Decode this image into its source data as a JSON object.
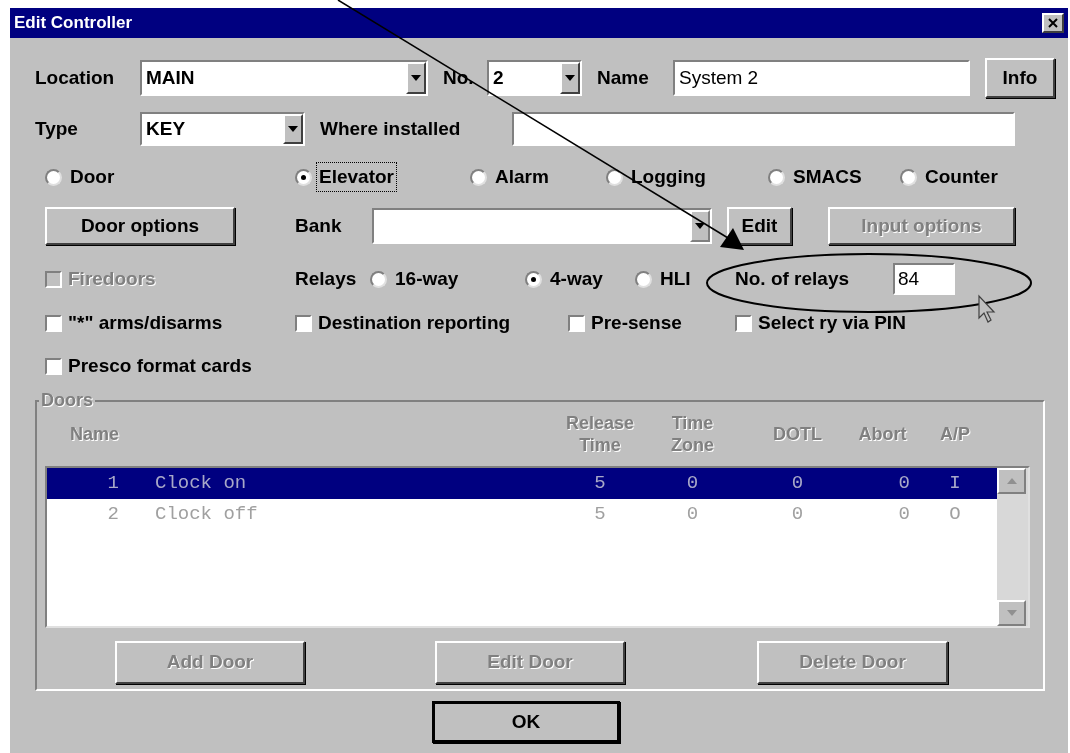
{
  "window": {
    "title": "Edit Controller"
  },
  "location": {
    "label": "Location",
    "value": "MAIN"
  },
  "number": {
    "label": "No.",
    "value": "2"
  },
  "name": {
    "label": "Name",
    "value": "System 2"
  },
  "info_button": {
    "label": "Info",
    "disabled": false
  },
  "type": {
    "label": "Type",
    "value": "KEY"
  },
  "where_installed": {
    "label": "Where installed"
  },
  "controller_kinds": [
    {
      "label": "Door",
      "selected": false,
      "focused": false
    },
    {
      "label": "Elevator",
      "selected": true,
      "focused": true
    },
    {
      "label": "Alarm",
      "selected": false,
      "focused": false
    },
    {
      "label": "Logging",
      "selected": false,
      "focused": false
    },
    {
      "label": "SMACS",
      "selected": false,
      "focused": false
    },
    {
      "label": "Counter",
      "selected": false,
      "focused": false
    }
  ],
  "door_options_button": {
    "label": "Door options",
    "disabled": false
  },
  "bank": {
    "label": "Bank"
  },
  "edit_button": {
    "label": "Edit",
    "disabled": false
  },
  "input_options_button": {
    "label": "Input options",
    "disabled": true
  },
  "relays": {
    "label": "Relays",
    "options": [
      {
        "label": "16-way",
        "selected": false
      },
      {
        "label": "4-way",
        "selected": true
      },
      {
        "label": "HLI",
        "selected": false
      }
    ]
  },
  "relay_count": {
    "label": "No. of relays",
    "value": "84"
  },
  "checkboxes": [
    {
      "label": "Firedoors",
      "checked": false,
      "disabled": true
    },
    {
      "label": "\"*\" arms/disarms",
      "checked": false,
      "disabled": false
    },
    {
      "label": "Destination reporting",
      "checked": false,
      "disabled": false
    },
    {
      "label": "Pre-sense",
      "checked": false,
      "disabled": false
    },
    {
      "label": "Select ry via PIN",
      "checked": false,
      "disabled": false
    },
    {
      "label": "Presco format cards",
      "checked": false,
      "disabled": false
    }
  ],
  "doors": {
    "title": "Doors",
    "columns": [
      "Name",
      "",
      "Release Time",
      "Time Zone",
      "DOTL",
      "Abort",
      "A/P"
    ],
    "rows": [
      {
        "cells": [
          "1",
          "Clock on",
          "5",
          "0",
          "0",
          "0",
          "I"
        ],
        "selected": true
      },
      {
        "cells": [
          "2",
          "Clock off",
          "5",
          "0",
          "0",
          "0",
          "O"
        ],
        "selected": false
      }
    ]
  },
  "door_buttons": [
    {
      "label": "Add Door",
      "disabled": true
    },
    {
      "label": "Edit Door",
      "disabled": true
    },
    {
      "label": "Delete Door",
      "disabled": true
    }
  ],
  "ok_button": {
    "label": "OK",
    "disabled": false
  }
}
